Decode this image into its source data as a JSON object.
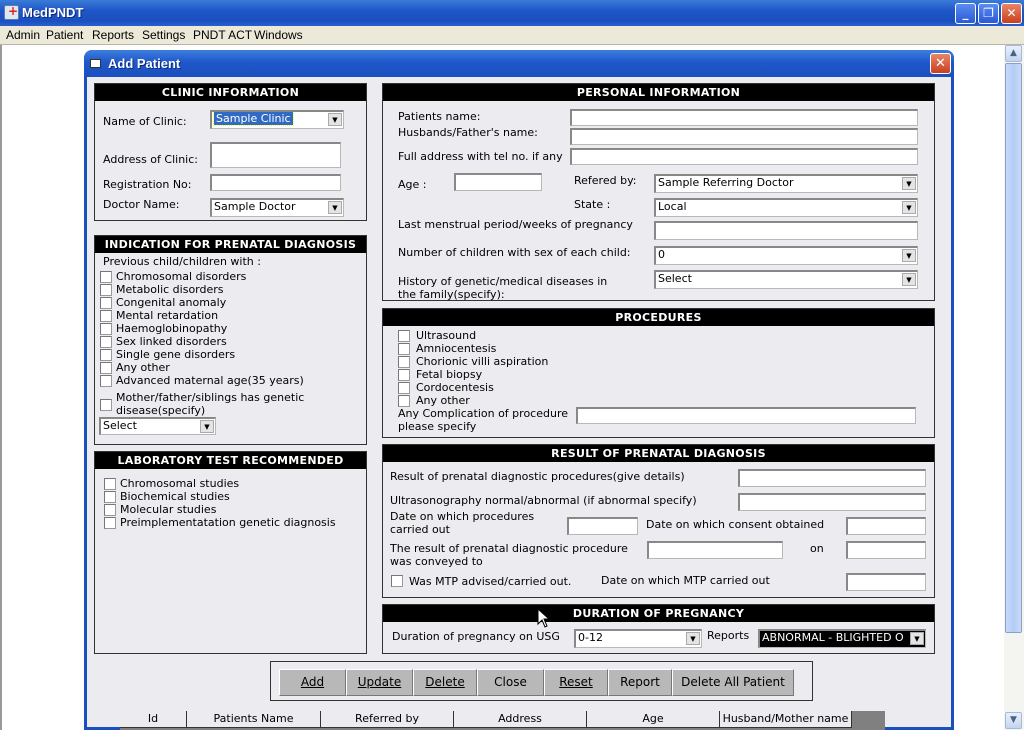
{
  "app": {
    "title": "MedPNDT",
    "menu": [
      "Admin",
      "Patient",
      "Reports",
      "Settings",
      "PNDT ACT",
      "Windows"
    ]
  },
  "dialog": {
    "title": "Add Patient"
  },
  "clinic": {
    "header": "CLINIC INFORMATION",
    "name_label": "Name of Clinic:",
    "name_value": "Sample Clinic",
    "address_label": "Address of Clinic:",
    "address_value": "",
    "reg_label": "Registration No:",
    "reg_value": "",
    "doctor_label": "Doctor Name:",
    "doctor_value": "Sample Doctor"
  },
  "indication": {
    "header": "INDICATION FOR PRENATAL DIAGNOSIS",
    "intro": "Previous child/children with :",
    "items": [
      "Chromosomal disorders",
      "Metabolic disorders",
      "Congenital anomaly",
      "Mental retardation",
      "Haemoglobinopathy",
      "Sex linked disorders",
      "Single gene disorders",
      "Any other",
      "Advanced maternal age(35 years)"
    ],
    "genetic_line1": "Mother/father/siblings has genetic",
    "genetic_line2": "disease(specify)",
    "select_value": "Select"
  },
  "lab": {
    "header": "LABORATORY TEST RECOMMENDED",
    "items": [
      "Chromosomal studies",
      "Biochemical studies",
      "Molecular studies",
      "Preimplementatation genetic diagnosis"
    ]
  },
  "personal": {
    "header": "PERSONAL INFORMATION",
    "patient_name_label": "Patients name:",
    "patient_name_value": "",
    "husband_label": "Husbands/Father's name:",
    "husband_value": "",
    "address_label": "Full address with tel no. if any",
    "address_value": "",
    "age_label": "Age :",
    "age_value": "",
    "referred_label": "Refered by:",
    "referred_value": "Sample Referring Doctor",
    "state_label": "State :",
    "state_value": "Local",
    "lmp_label": "Last menstrual period/weeks of pregnancy",
    "lmp_value": "",
    "children_label": "Number of children with sex of each child:",
    "children_value": "0",
    "history_label1": "History of genetic/medical diseases in",
    "history_label2": "the family(specify):",
    "history_value": "Select"
  },
  "procedures": {
    "header": "PROCEDURES",
    "items": [
      "Ultrasound",
      "Amniocentesis",
      "Chorionic villi aspiration",
      "Fetal biopsy",
      "Cordocentesis",
      "Any other"
    ],
    "complication_label1": "Any Complication of procedure",
    "complication_label2": "please specify",
    "complication_value": ""
  },
  "result": {
    "header": "RESULT OF PRENATAL DIAGNOSIS",
    "details_label": "Result of prenatal diagnostic procedures(give details)",
    "usg_label": "Ultrasonography normal/abnormal (if abnormal specify)",
    "date_proc_label1": "Date on which procedures",
    "date_proc_label2": "carried out",
    "consent_label": "Date on which consent obtained",
    "conveyed_label1": "The result of prenatal diagnostic procedure",
    "conveyed_label2": "was conveyed to",
    "on_label": "on",
    "mtp_label": "Was MTP advised/carried out.",
    "mtp_date_label": "Date on which MTP carried out"
  },
  "duration": {
    "header": "DURATION OF PREGNANCY",
    "usg_label": "Duration of pregnancy on USG",
    "usg_value": "0-12",
    "reports_label": "Reports",
    "reports_value": "ABNORMAL - BLIGHTED O"
  },
  "buttons": [
    "Add",
    "Update",
    "Delete",
    "Close",
    "Reset",
    "Report",
    "Delete All Patient"
  ],
  "table": {
    "columns": [
      "Id",
      "Patients Name",
      "Referred by",
      "Address",
      "Age",
      "Husband/Mother name"
    ]
  }
}
